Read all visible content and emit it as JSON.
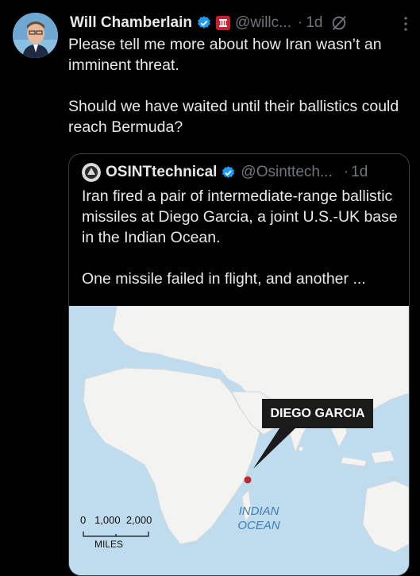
{
  "tweet": {
    "author_name": "Will Chamberlain",
    "handle": "@willc...",
    "separator": "·",
    "time": "1d",
    "paragraphs": [
      "Please tell me more about how Iran wasn’t an imminent threat.",
      "Should we have waited until their ballistics could reach Bermuda?"
    ]
  },
  "quote": {
    "author_name": "OSINTtechnical",
    "handle": "@Osinttech...",
    "separator": "·",
    "time": "1d",
    "paragraphs": [
      "Iran fired a pair of intermediate-range ballistic missiles at Diego Garcia, a joint U.S.-UK base in the Indian Ocean.",
      "One missile failed in flight, and another ..."
    ],
    "map": {
      "callout": "DIEGO GARCIA",
      "ocean_label_line1": "INDIAN",
      "ocean_label_line2": "OCEAN",
      "scale_labels": "0   1,000  2,000",
      "scale_unit": "MILES"
    }
  },
  "icons": {
    "verified": "verified-badge-icon",
    "affiliation": "affiliation-badge-icon",
    "grok": "grok-icon",
    "more": "more-options-icon"
  },
  "colors": {
    "background": "#000000",
    "text": "#e7e9ea",
    "muted": "#71767b",
    "verified": "#1d9bf0",
    "affiliation": "#c8202f",
    "map_water": "#bfdcee",
    "map_land": "#f3f3f1",
    "marker": "#c0262d"
  }
}
